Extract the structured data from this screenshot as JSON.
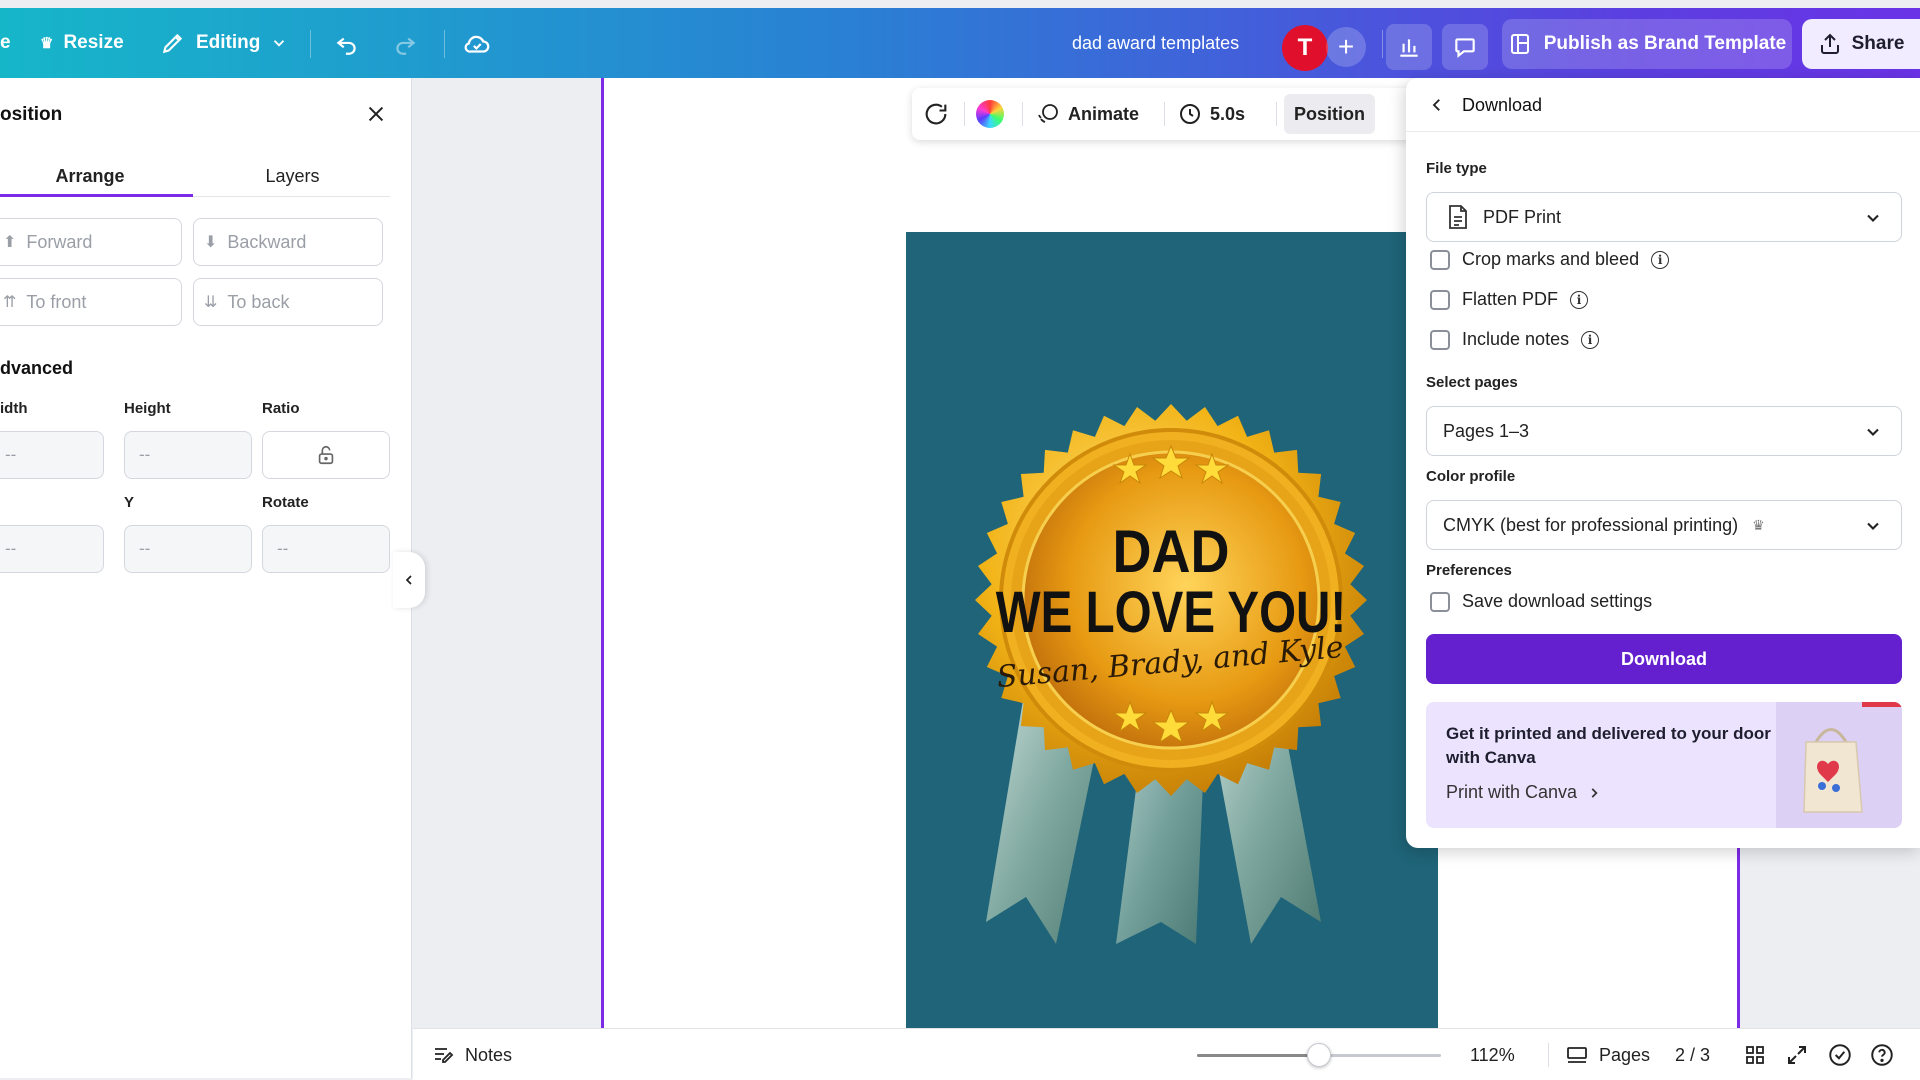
{
  "topbar": {
    "resize_label": "Resize",
    "editing_label": "Editing",
    "doc_title": "dad award templates",
    "avatar_initial": "T",
    "publish_label": "Publish as Brand Template",
    "share_label": "Share"
  },
  "left_panel": {
    "title": "osition",
    "tabs": [
      "Arrange",
      "Layers"
    ],
    "active_tab": "Arrange",
    "arrange_buttons": [
      "Forward",
      "Backward",
      "To front",
      "To back"
    ],
    "advanced_title": "dvanced",
    "labels": {
      "width": "idth",
      "height": "Height",
      "ratio": "Ratio",
      "x": "",
      "y": "Y",
      "rotate": "Rotate"
    },
    "field_values": {
      "width": "--",
      "height": "--",
      "x": "--",
      "y": "--",
      "rotate": "--"
    }
  },
  "float_toolbar": {
    "animate_label": "Animate",
    "duration_label": "5.0s",
    "position_label": "Position"
  },
  "design": {
    "line1": "DAD",
    "line2": "WE LOVE YOU!",
    "signature": "Susan, Brady, and Kyle",
    "background_color": "#1f6478"
  },
  "download_panel": {
    "title": "Download",
    "file_type_label": "File type",
    "file_type_value": "PDF Print",
    "options": [
      {
        "label": "Crop marks and bleed",
        "checked": false
      },
      {
        "label": "Flatten PDF",
        "checked": false
      },
      {
        "label": "Include notes",
        "checked": false
      }
    ],
    "select_pages_label": "Select pages",
    "select_pages_value": "Pages 1–3",
    "color_profile_label": "Color profile",
    "color_profile_value": "CMYK (best for professional printing)",
    "preferences_label": "Preferences",
    "save_settings_label": "Save download settings",
    "download_button": "Download",
    "promo_text": "Get it printed and delivered to your door with Canva",
    "promo_link": "Print with Canva"
  },
  "bottombar": {
    "notes_label": "Notes",
    "zoom": "112%",
    "zoom_fraction": 0.5,
    "pages_label": "Pages",
    "page_indicator": "2 / 3"
  },
  "colors": {
    "accent": "#7d2ae8",
    "download_button": "#6420cf",
    "avatar": "#e0102d"
  }
}
